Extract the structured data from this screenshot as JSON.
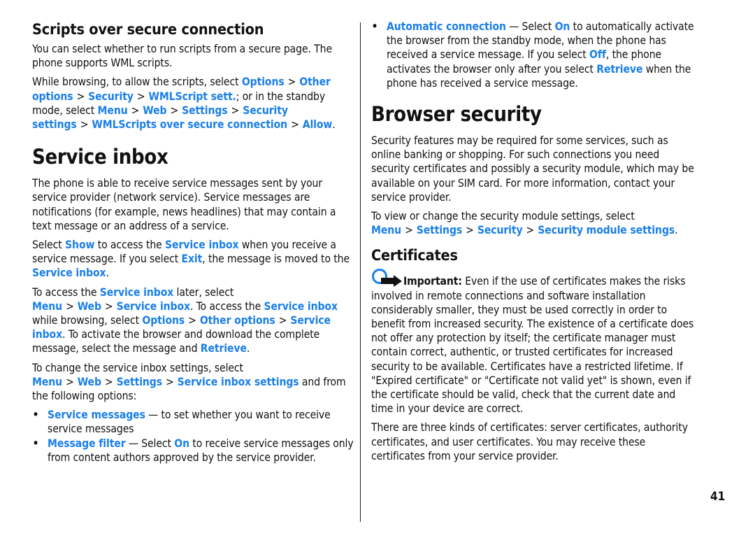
{
  "page_number": "41",
  "colors": {
    "link": "#1a7fe8",
    "text": "#111111"
  },
  "left": {
    "scripts": {
      "heading": "Scripts over secure connection",
      "p1": "You can select whether to run scripts from a secure page. The phone supports WML scripts.",
      "p2": {
        "t1": "While browsing, to allow the scripts, select ",
        "l1": "Options",
        "l2": "Other options",
        "l3": "Security",
        "l4": "WMLScript sett.",
        "t2": "; or in the standby mode, select ",
        "l5": "Menu",
        "l6": "Web",
        "l7": "Settings",
        "l8": "Security settings",
        "l9": "WMLScripts over secure connection",
        "l10": "Allow",
        "t3": "."
      }
    },
    "inbox": {
      "heading": "Service inbox",
      "p1": "The phone is able to receive service messages sent by your service provider (network service). Service messages are notifications (for example, news headlines) that may contain a text message or an address of a service.",
      "p2": {
        "t1": "Select ",
        "l1": "Show",
        "t2": " to access the ",
        "l2": "Service inbox",
        "t3": " when you receive a service message. If you select ",
        "l3": "Exit",
        "t4": ", the message is moved to the ",
        "l4": "Service inbox",
        "t5": "."
      },
      "p3": {
        "t1": "To access the ",
        "l1": "Service inbox",
        "t2": " later, select ",
        "l2": "Menu",
        "l3": "Web",
        "l4": "Service inbox",
        "t3": ". To access the ",
        "l5": "Service inbox",
        "t4": " while browsing, select ",
        "l6": "Options",
        "l7": "Other options",
        "l8": "Service inbox",
        "t5": ". To activate the browser and download the complete message, select the message and ",
        "l9": "Retrieve",
        "t6": "."
      },
      "p4": {
        "t1": "To change the service inbox settings, select ",
        "l1": "Menu",
        "l2": "Web",
        "l3": "Settings",
        "l4": "Service inbox settings",
        "t2": " and from the following options:"
      },
      "bullets": [
        {
          "l1": "Service messages",
          "t1": " — to set whether you want to receive service messages"
        },
        {
          "l1": "Message filter",
          "t1": " — Select ",
          "l2": "On",
          "t2": " to receive service messages only from content authors approved by the service provider."
        }
      ]
    }
  },
  "right": {
    "bullet": {
      "l1": "Automatic connection",
      "t1": " — Select ",
      "l2": "On",
      "t2": " to automatically activate the browser from the standby mode, when the phone has received a service message. If you select ",
      "l3": "Off",
      "t3": ", the phone activates the browser only after you select ",
      "l4": "Retrieve",
      "t4": " when the phone has received a service message."
    },
    "security": {
      "heading": "Browser security",
      "p1": "Security features may be required for some services, such as online banking or shopping. For such connections you need security certificates and possibly a security module, which may be available on your SIM card. For more information, contact your service provider.",
      "p2": {
        "t1": "To view or change the security module settings, select ",
        "l1": "Menu",
        "l2": "Settings",
        "l3": "Security",
        "l4": "Security module settings",
        "t2": "."
      }
    },
    "certificates": {
      "heading": "Certificates",
      "important_label": "Important:",
      "important_text": " Even if the use of certificates makes the risks involved in remote connections and software installation considerably smaller, they must be used correctly in order to benefit from increased security. The existence of a certificate does not offer any protection by itself; the certificate manager must contain correct, authentic, or trusted certificates for increased security to be available. Certificates have a restricted lifetime. If \"Expired certificate\" or \"Certificate not valid yet\" is shown, even if the certificate should be valid, check that the current date and time in your device are correct.",
      "p2": "There are three kinds of certificates: server certificates, authority certificates, and user certificates. You may receive these certificates from your service provider."
    },
    "separator": ">"
  }
}
